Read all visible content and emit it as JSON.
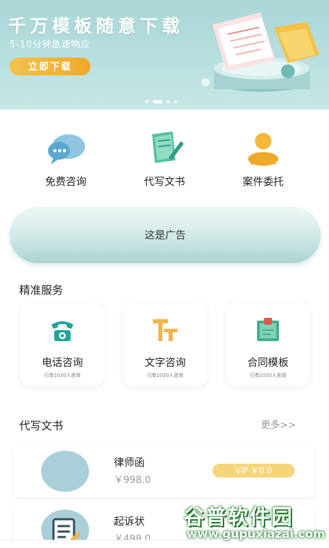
{
  "banner": {
    "title": "千万模板随意下载",
    "subtitle": "5-10分钟急速响应",
    "button_label": "立即下载",
    "dots": 4,
    "active_dot": 1
  },
  "quick_actions": [
    {
      "label": "免费咨询",
      "icon": "consult-bubble-icon"
    },
    {
      "label": "代写文书",
      "icon": "document-pen-icon"
    },
    {
      "label": "案件委托",
      "icon": "person-icon"
    }
  ],
  "ad": {
    "label": "这是广告"
  },
  "precise_services": {
    "title": "精准服务",
    "cards": [
      {
        "title": "电话咨询",
        "subtitle": "已有1020人咨询",
        "icon": "telephone-icon"
      },
      {
        "title": "文字咨询",
        "subtitle": "已有1020人咨询",
        "icon": "text-tt-icon"
      },
      {
        "title": "合同模板",
        "subtitle": "已有1020人咨询",
        "icon": "contract-template-icon"
      }
    ]
  },
  "documents": {
    "title": "代写文书",
    "more_label": "更多>>",
    "items": [
      {
        "name": "律师函",
        "price": "￥998.0",
        "vip": "VIP ￥0.0"
      },
      {
        "name": "起诉状",
        "price": "￥498.0"
      }
    ]
  },
  "watermark": {
    "text": "谷普软件园",
    "url": "www.gupuxiazai.com"
  },
  "colors": {
    "accent": "#a9d6d6",
    "gold": "#f0a92a",
    "teal": "#2f9b8a"
  }
}
